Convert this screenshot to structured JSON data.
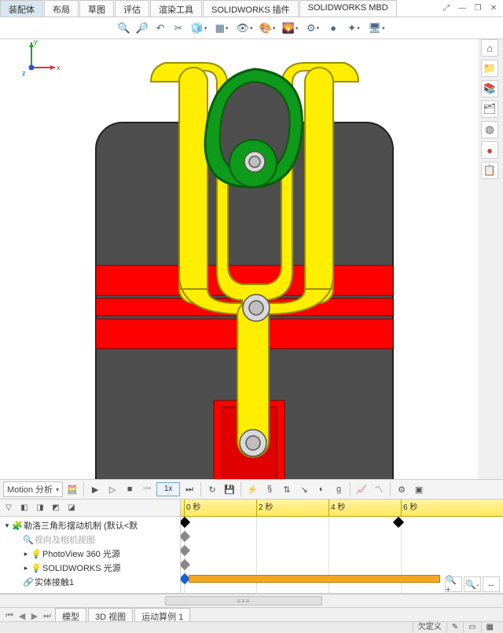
{
  "tabs": {
    "assembly": "装配体",
    "layout": "布局",
    "sketch": "草图",
    "evaluate": "评估",
    "render": "渲染工具",
    "addins": "SOLIDWORKS 插件",
    "mbd": "SOLIDWORKS MBD"
  },
  "motion": {
    "study_type": "Motion 分析",
    "speed": "1x"
  },
  "tree": {
    "root": "勒洛三角形摆动机制  (默认<默",
    "cam": "视向及相机视图",
    "pv": "PhotoView 360 光源",
    "sw": "SOLIDWORKS 光源",
    "contact": "实体接触1"
  },
  "timeline": {
    "t0": "0 秒",
    "t2": "2 秒",
    "t4": "4 秒",
    "t6": "6 秒"
  },
  "triad": {
    "x": "x",
    "y": "y",
    "z": "z"
  },
  "bottom": {
    "model": "模型",
    "view3d": "3D 视图",
    "motion1": "运动算例 1"
  },
  "status": {
    "underdef": "欠定义"
  }
}
